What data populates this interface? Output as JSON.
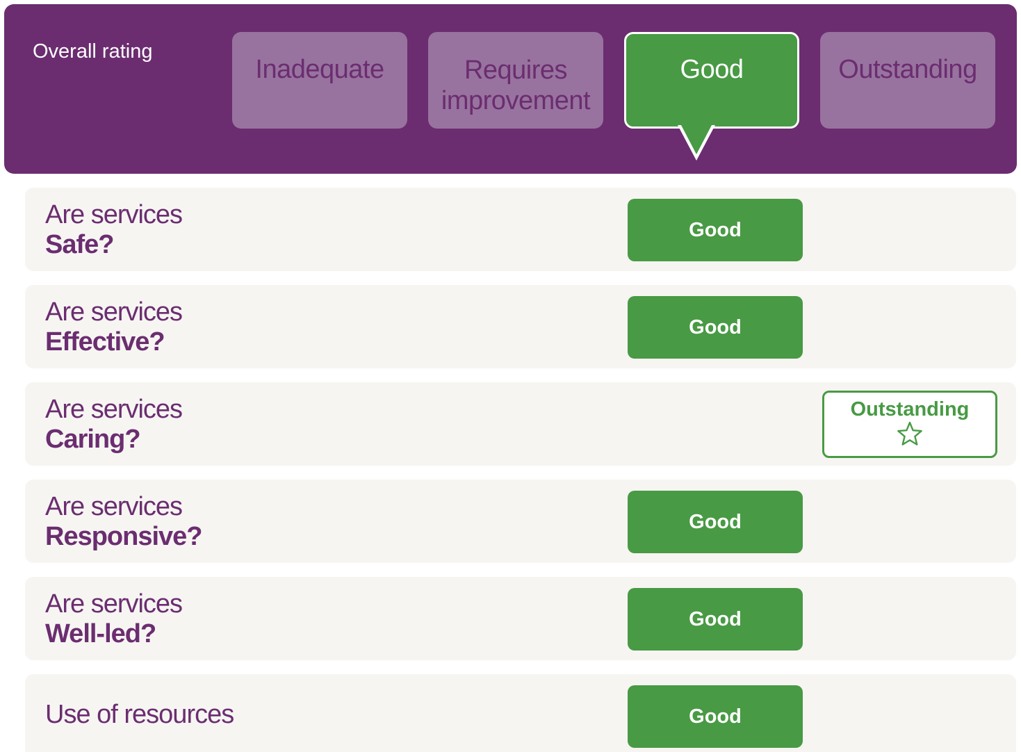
{
  "overall": {
    "label": "Overall rating",
    "scale": [
      {
        "line1": "Inadequate",
        "line2": ""
      },
      {
        "line1": "Requires",
        "line2": "improvement"
      },
      {
        "line1": "Good",
        "line2": ""
      },
      {
        "line1": "Outstanding",
        "line2": ""
      }
    ],
    "selected": "Good"
  },
  "questions": [
    {
      "prefix": "Are services",
      "name": "Safe?",
      "rating": "Good"
    },
    {
      "prefix": "Are services",
      "name": "Effective?",
      "rating": "Good"
    },
    {
      "prefix": "Are services",
      "name": "Caring?",
      "rating": "Outstanding"
    },
    {
      "prefix": "Are services",
      "name": "Responsive?",
      "rating": "Good"
    },
    {
      "prefix": "Are services",
      "name": "Well-led?",
      "rating": "Good"
    }
  ],
  "resources": {
    "label": "Use of resources",
    "rating": "Good"
  },
  "colors": {
    "purple": "#6b2d70",
    "purple_light": "#98739f",
    "green": "#489a44",
    "row_bg": "#f6f5f2"
  },
  "icons": {
    "outstanding": "star-outline-icon"
  }
}
